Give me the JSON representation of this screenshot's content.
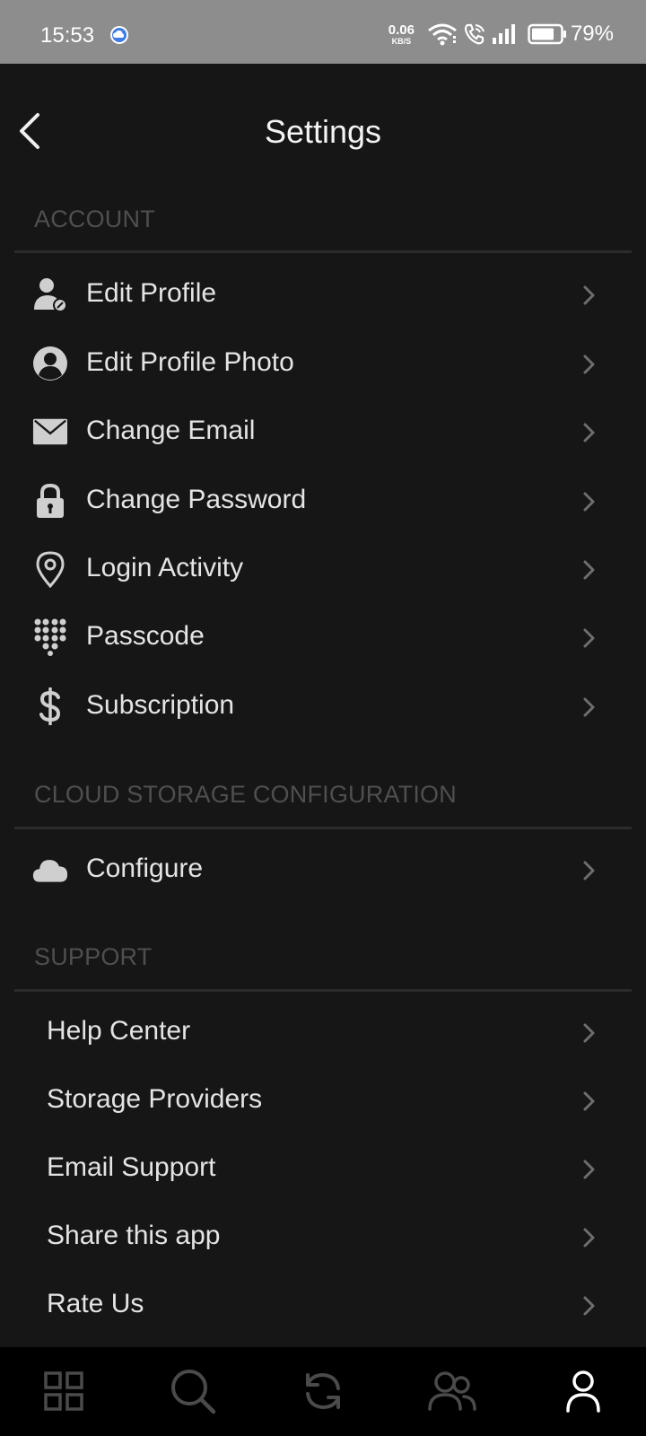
{
  "status_bar": {
    "time": "15:53",
    "net_speed_value": "0.06",
    "net_speed_unit": "KB/S",
    "battery_percent": "79%",
    "icons": [
      "weather-cloud-icon",
      "wifi-icon",
      "wifi-call-icon",
      "signal-icon",
      "battery-icon"
    ]
  },
  "header": {
    "title": "Settings",
    "back_icon": "chevron-left-icon"
  },
  "sections": {
    "account": {
      "label": "ACCOUNT",
      "items": [
        {
          "label": "Edit Profile",
          "icon": "user-edit-icon"
        },
        {
          "label": "Edit Profile Photo",
          "icon": "profile-photo-icon"
        },
        {
          "label": "Change Email",
          "icon": "envelope-icon"
        },
        {
          "label": "Change Password",
          "icon": "lock-icon"
        },
        {
          "label": "Login Activity",
          "icon": "location-pin-icon"
        },
        {
          "label": "Passcode",
          "icon": "keypad-icon"
        },
        {
          "label": "Subscription",
          "icon": "dollar-icon"
        }
      ]
    },
    "cloud": {
      "label": "CLOUD STORAGE CONFIGURATION",
      "items": [
        {
          "label": "Configure",
          "icon": "cloud-icon"
        }
      ]
    },
    "support": {
      "label": "SUPPORT",
      "items": [
        {
          "label": "Help Center"
        },
        {
          "label": "Storage Providers"
        },
        {
          "label": "Email Support"
        },
        {
          "label": "Share this app"
        },
        {
          "label": "Rate Us"
        }
      ]
    }
  },
  "bottom_nav": {
    "items": [
      "grid-icon",
      "search-icon",
      "sync-icon",
      "users-icon",
      "profile-icon"
    ],
    "active": "profile-icon"
  },
  "colors": {
    "background": "#161616",
    "status_bar": "#8d8d8d",
    "section_label": "#4f4f4f",
    "text": "#e4e4e4",
    "icon": "#cfcfcf",
    "chevron": "#6e6e6e",
    "nav_background": "#000000",
    "nav_inactive": "#4a4a4a",
    "nav_active": "#ffffff"
  }
}
